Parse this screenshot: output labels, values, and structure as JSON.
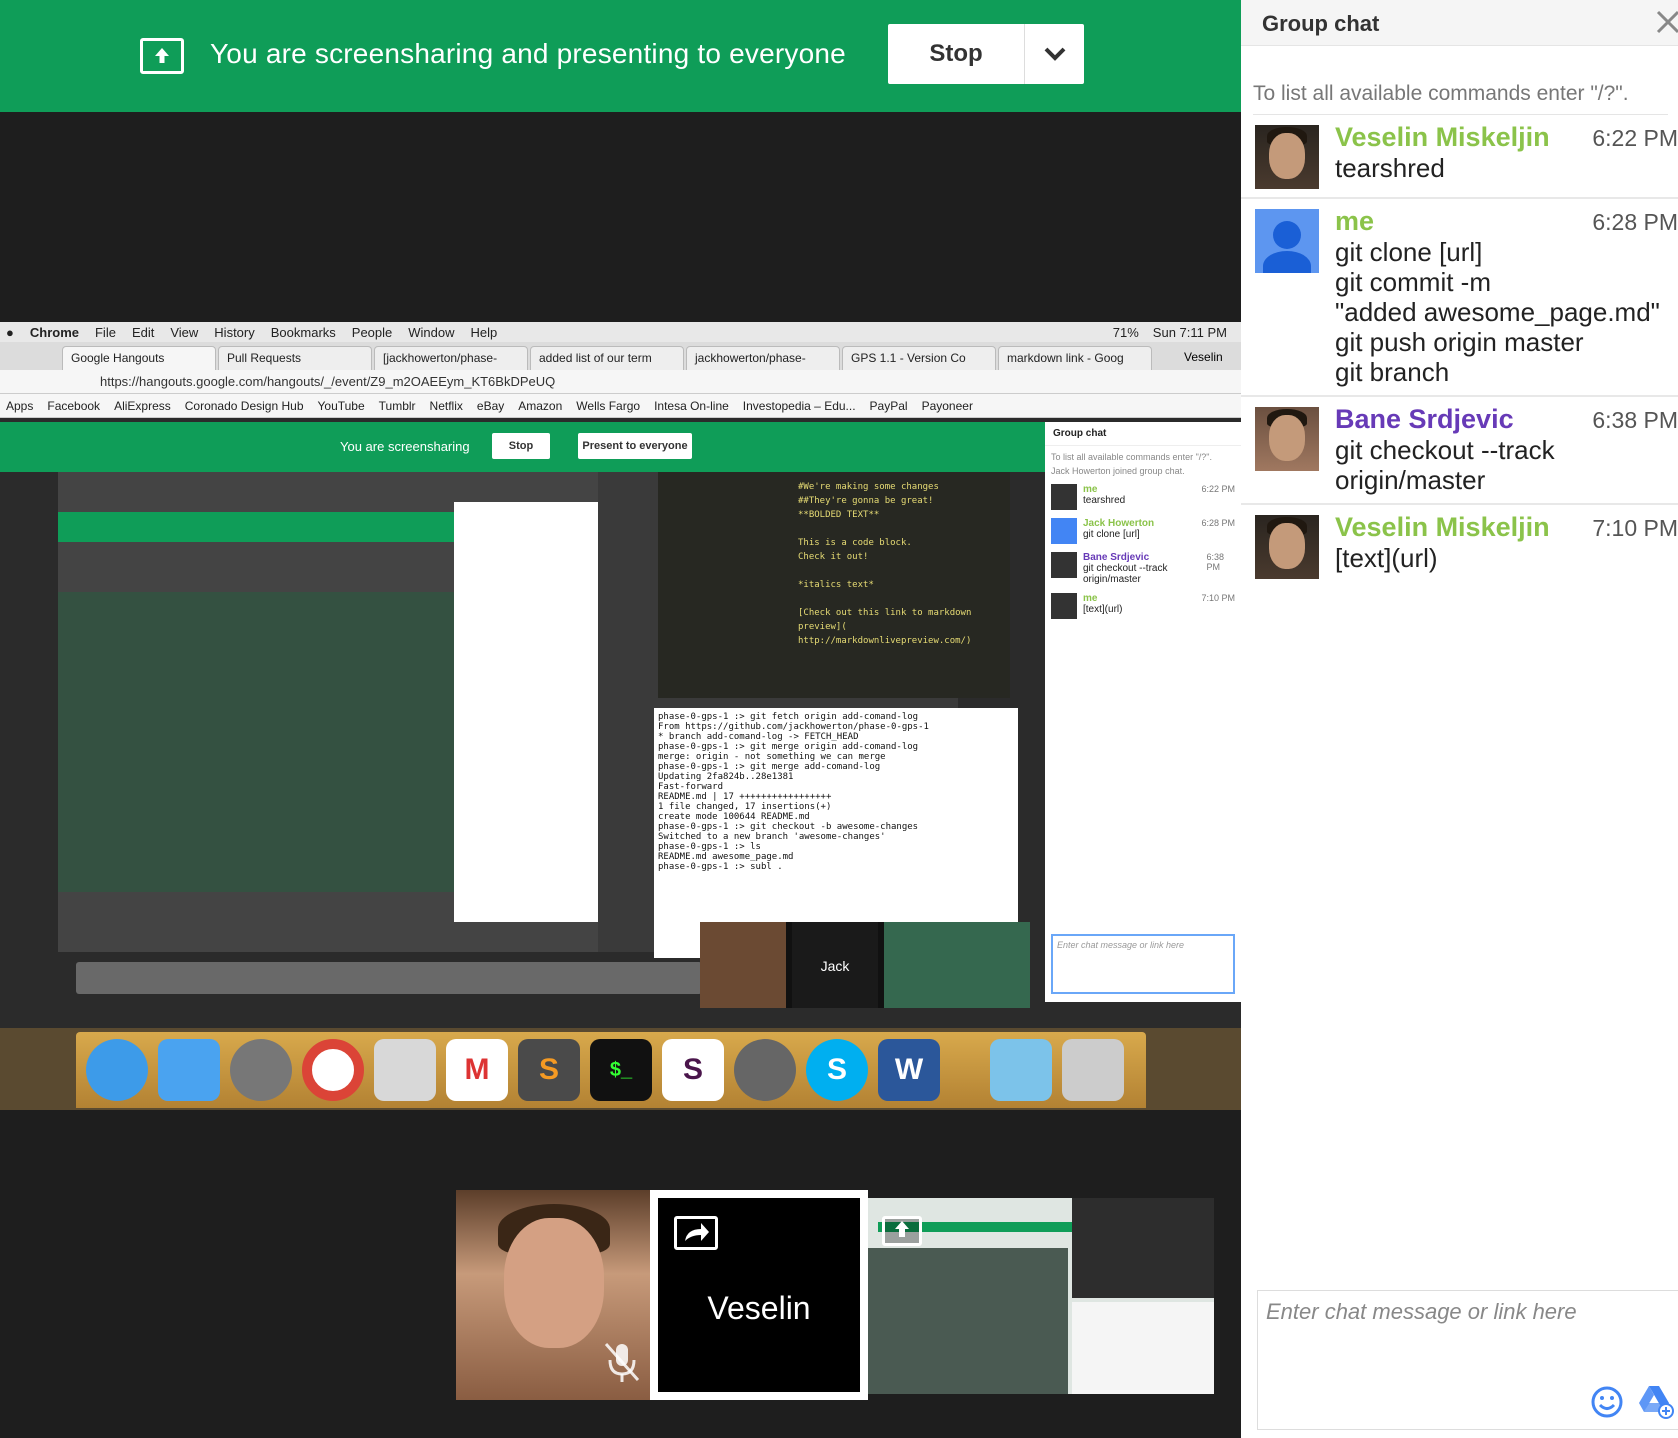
{
  "banner": {
    "text": "You are screensharing and presenting to everyone",
    "stop_label": "Stop"
  },
  "shared_screen": {
    "menubar": [
      "Chrome",
      "File",
      "Edit",
      "View",
      "History",
      "Bookmarks",
      "People",
      "Window",
      "Help"
    ],
    "battery": "71%",
    "clock": "Sun 7:11 PM",
    "tabs": [
      "Google Hangouts",
      "Pull Requests",
      "[jackhowerton/phase-",
      "added list of our term",
      "jackhowerton/phase-",
      "GPS 1.1 - Version Co",
      "markdown link - Goog"
    ],
    "profile": "Veselin",
    "url": "https://hangouts.google.com/hangouts/_/event/Z9_m2OAEEym_KT6BkDPeUQ",
    "bookmarks": [
      "Apps",
      "Facebook",
      "AliExpress",
      "Coronado Design Hub",
      "YouTube",
      "Tumblr",
      "Netflix",
      "eBay",
      "Amazon",
      "Wells Fargo",
      "Intesa On-line",
      "Investopedia – Edu...",
      "PayPal",
      "Payoneer"
    ],
    "inner_banner_text": "You are screensharing",
    "inner_stop": "Stop",
    "inner_present": "Present to everyone",
    "inner_chat": {
      "title": "Group chat",
      "hint": "To list all available commands enter \"/?\".",
      "joined": "Jack Howerton joined group chat.",
      "messages": [
        {
          "name": "me",
          "time": "6:22 PM",
          "text": "tearshred"
        },
        {
          "name": "Jack Howerton",
          "time": "6:28 PM",
          "text": "git clone [url]"
        },
        {
          "name": "Bane Srdjevic",
          "time": "6:38 PM",
          "text": "git checkout --track origin/master"
        },
        {
          "name": "me",
          "time": "7:10 PM",
          "text": "[text](url)"
        }
      ],
      "input_placeholder": "Enter chat message or link here"
    },
    "code_lines": [
      "#We're making some changes",
      "##They're gonna be great!",
      "**BOLDED TEXT**",
      "This is a code block.",
      "Check it out!",
      "*italics text*",
      "[Check out this link to markdown preview](",
      "http://markdownlivepreview.com/)"
    ],
    "terminal_lines": [
      "phase-0-gps-1 :> git fetch origin add-comand-log",
      "From https://github.com/jackhowerton/phase-0-gps-1",
      " * branch            add-comand-log -> FETCH_HEAD",
      "phase-0-gps-1 :> git merge origin add-comand-log",
      "merge: origin - not something we can merge",
      "phase-0-gps-1 :> git merge add-comand-log",
      "Updating 2fa824b..28e1381",
      "Fast-forward",
      " README.md | 17 +++++++++++++++++",
      " 1 file changed, 17 insertions(+)",
      " create mode 100644 README.md",
      "phase-0-gps-1 :> git checkout -b awesome-changes",
      "Switched to a new branch 'awesome-changes'",
      "phase-0-gps-1 :> ls",
      "README.md       awesome_page.md",
      "phase-0-gps-1 :> subl ."
    ],
    "jack_label": "Jack"
  },
  "participants": {
    "self_name": "Veselin"
  },
  "chat": {
    "title": "Group chat",
    "hint": "To list all available commands enter \"/?\".",
    "messages": [
      {
        "name": "Veselin Miskeljin",
        "time": "6:22 PM",
        "lines": [
          "tearshred"
        ]
      },
      {
        "name": "me",
        "time": "6:28 PM",
        "lines": [
          "git clone [url]",
          "git commit -m",
          "\"added awesome_page.md\"",
          "git push origin master",
          "git branch"
        ]
      },
      {
        "name": "Bane Srdjevic",
        "time": "6:38 PM",
        "lines": [
          "git checkout --track",
          "origin/master"
        ]
      },
      {
        "name": "Veselin Miskeljin",
        "time": "7:10 PM",
        "lines": [
          "[text](url)"
        ]
      }
    ],
    "input_placeholder": "Enter chat message or link here"
  },
  "colors": {
    "brand_green": "#0f9d58",
    "name_green": "#8bc34a",
    "name_purple": "#673ab7",
    "me_blue": "#4285f4"
  }
}
